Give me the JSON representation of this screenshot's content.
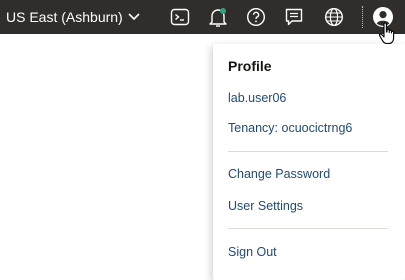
{
  "topbar": {
    "region_label": "US East (Ashburn)",
    "icons": [
      "cloud-shell-icon",
      "notifications-icon",
      "help-icon",
      "feedback-icon",
      "language-icon",
      "profile-avatar-icon"
    ],
    "background": "#312d2a"
  },
  "profile_menu": {
    "heading": "Profile",
    "username": "lab.user06",
    "tenancy": "Tenancy: ocuocictrng6",
    "change_password": "Change Password",
    "user_settings": "User Settings",
    "sign_out": "Sign Out",
    "link_color": "#1f4a7d"
  }
}
